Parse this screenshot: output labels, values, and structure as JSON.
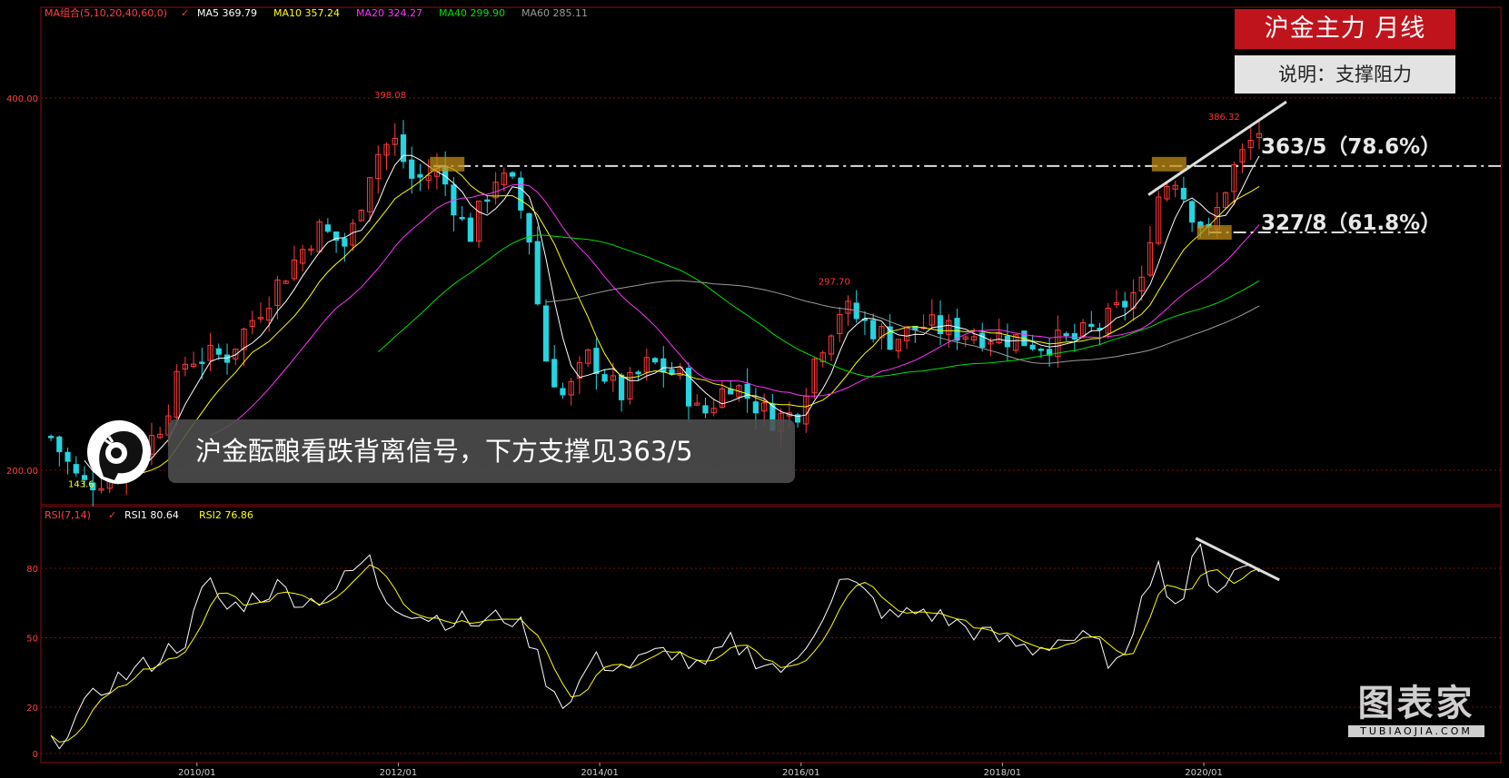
{
  "panel": {
    "title": "沪金主力  月线",
    "subtitle": "说明：支撑阻力",
    "ma_header": {
      "label": "MA组合(5,10,20,40,60,0)",
      "items": [
        {
          "text": "MA5 369.79",
          "color": "#ffffff"
        },
        {
          "text": "MA10 357.24",
          "color": "#ffff00"
        },
        {
          "text": "MA20 324.27",
          "color": "#ff33ff"
        },
        {
          "text": "MA40 299.90",
          "color": "#00e000"
        },
        {
          "text": "MA60 285.11",
          "color": "#9a9a9a"
        }
      ]
    },
    "rsi_header": {
      "label": "RSI(7,14)",
      "items": [
        {
          "text": "RSI1 80.64",
          "color": "#ffffff"
        },
        {
          "text": "RSI2 76.86",
          "color": "#ffff00"
        }
      ]
    },
    "levels": [
      {
        "text": "363/5（78.6%）",
        "value": 363.5
      },
      {
        "text": "327/8（61.8%）",
        "value": 327.8
      }
    ],
    "banner": "沪金酝酿看跌背离信号，下方支撑见363/5",
    "watermark": {
      "cn": "图表家",
      "en": "TUBIAOJIA.COM"
    }
  },
  "chart_data": {
    "type": "candlestick",
    "price_axis": {
      "ticks": [
        200,
        400
      ],
      "labels": [
        "200.00",
        "400.00"
      ],
      "ylim": [
        180,
        435
      ]
    },
    "rsi_axis": {
      "ticks": [
        0,
        20,
        50,
        80
      ],
      "ylim": [
        0,
        100
      ]
    },
    "x_ticks": [
      "2010/01",
      "2012/01",
      "2014/01",
      "2016/01",
      "2018/01",
      "2020/01"
    ],
    "annotations": [
      {
        "text": "398.08",
        "x": 2011.92,
        "y": 398.08,
        "color": "#ff3333"
      },
      {
        "text": "297.70",
        "x": 2016.33,
        "y": 297.7,
        "color": "#ff3333"
      },
      {
        "text": "386.32",
        "x": 2020.2,
        "y": 386.32,
        "color": "#ff3333"
      },
      {
        "text": "143.6",
        "x": 2008.85,
        "y": 189,
        "color": "#ffff00"
      }
    ],
    "series": [
      {
        "name": "MA5",
        "color": "#ffffff"
      },
      {
        "name": "MA10",
        "color": "#ffff00"
      },
      {
        "name": "MA20",
        "color": "#ff33ff"
      },
      {
        "name": "MA40",
        "color": "#00e000"
      },
      {
        "name": "MA60",
        "color": "#9a9a9a"
      },
      {
        "name": "RSI1",
        "color": "#ffffff"
      },
      {
        "name": "RSI2",
        "color": "#ffff00"
      }
    ],
    "anchors": [
      [
        2008.55,
        218
      ],
      [
        2008.85,
        192
      ],
      [
        2009.2,
        198
      ],
      [
        2009.6,
        220
      ],
      [
        2009.9,
        260
      ],
      [
        2010.3,
        262
      ],
      [
        2010.8,
        300
      ],
      [
        2011.2,
        330
      ],
      [
        2011.5,
        320
      ],
      [
        2011.75,
        368
      ],
      [
        2011.95,
        378
      ],
      [
        2012.15,
        355
      ],
      [
        2012.4,
        362
      ],
      [
        2012.7,
        325
      ],
      [
        2012.95,
        358
      ],
      [
        2013.15,
        352
      ],
      [
        2013.3,
        325
      ],
      [
        2013.45,
        262
      ],
      [
        2013.65,
        238
      ],
      [
        2013.9,
        262
      ],
      [
        2014.2,
        240
      ],
      [
        2014.5,
        258
      ],
      [
        2014.8,
        250
      ],
      [
        2015.0,
        228
      ],
      [
        2015.3,
        248
      ],
      [
        2015.7,
        228
      ],
      [
        2015.95,
        230
      ],
      [
        2016.15,
        262
      ],
      [
        2016.4,
        288
      ],
      [
        2016.6,
        280
      ],
      [
        2016.9,
        270
      ],
      [
        2017.2,
        278
      ],
      [
        2017.6,
        274
      ],
      [
        2018.0,
        272
      ],
      [
        2018.4,
        268
      ],
      [
        2018.7,
        270
      ],
      [
        2019.0,
        278
      ],
      [
        2019.4,
        300
      ],
      [
        2019.5,
        343
      ],
      [
        2019.7,
        360
      ],
      [
        2019.85,
        342
      ],
      [
        2020.05,
        326
      ],
      [
        2020.25,
        358
      ],
      [
        2020.45,
        375
      ],
      [
        2020.6,
        386
      ]
    ],
    "rsi_anchors": [
      [
        2008.55,
        3
      ],
      [
        2008.8,
        15
      ],
      [
        2009.1,
        30
      ],
      [
        2009.5,
        38
      ],
      [
        2009.9,
        50
      ],
      [
        2010.1,
        75
      ],
      [
        2010.3,
        62
      ],
      [
        2010.8,
        72
      ],
      [
        2011.1,
        65
      ],
      [
        2011.4,
        72
      ],
      [
        2011.7,
        85
      ],
      [
        2011.85,
        68
      ],
      [
        2012.2,
        60
      ],
      [
        2012.5,
        58
      ],
      [
        2012.8,
        56
      ],
      [
        2013.1,
        60
      ],
      [
        2013.3,
        50
      ],
      [
        2013.5,
        30
      ],
      [
        2013.7,
        20
      ],
      [
        2013.9,
        40
      ],
      [
        2014.3,
        38
      ],
      [
        2014.7,
        45
      ],
      [
        2015.0,
        35
      ],
      [
        2015.3,
        48
      ],
      [
        2015.6,
        40
      ],
      [
        2015.9,
        35
      ],
      [
        2016.2,
        60
      ],
      [
        2016.4,
        75
      ],
      [
        2016.6,
        70
      ],
      [
        2016.9,
        58
      ],
      [
        2017.2,
        62
      ],
      [
        2017.6,
        55
      ],
      [
        2017.9,
        50
      ],
      [
        2018.3,
        45
      ],
      [
        2018.6,
        50
      ],
      [
        2018.9,
        48
      ],
      [
        2019.2,
        35
      ],
      [
        2019.4,
        75
      ],
      [
        2019.55,
        80
      ],
      [
        2019.75,
        62
      ],
      [
        2019.95,
        90
      ],
      [
        2020.1,
        70
      ],
      [
        2020.3,
        78
      ],
      [
        2020.45,
        82
      ],
      [
        2020.6,
        80
      ]
    ]
  }
}
